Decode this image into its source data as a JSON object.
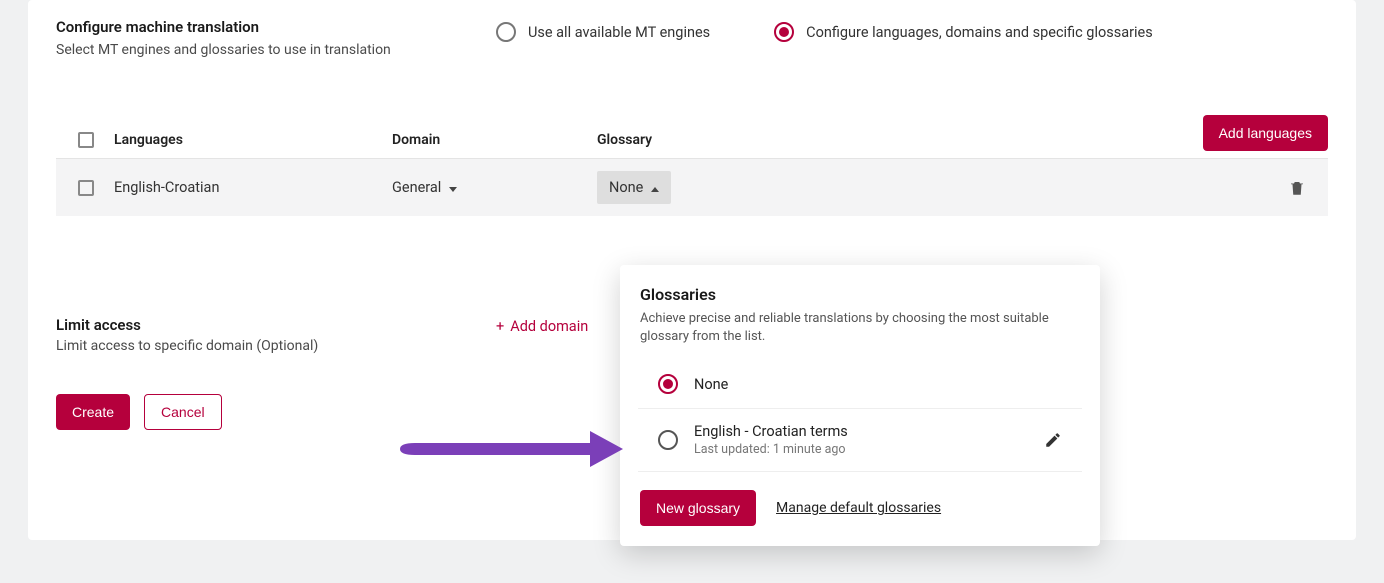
{
  "header": {
    "title": "Configure machine translation",
    "subtitle": "Select MT engines and glossaries to use in translation"
  },
  "mode_options": {
    "use_all": "Use all available MT engines",
    "configure": "Configure languages, domains and specific glossaries"
  },
  "buttons": {
    "add_languages": "Add languages",
    "create": "Create",
    "cancel": "Cancel",
    "new_glossary": "New glossary",
    "manage_glossaries": "Manage default glossaries",
    "add_domain": "Add domain"
  },
  "table": {
    "headers": {
      "languages": "Languages",
      "domain": "Domain",
      "glossary": "Glossary"
    },
    "rows": [
      {
        "languages": "English-Croatian",
        "domain": "General",
        "glossary": "None"
      }
    ]
  },
  "limit": {
    "title": "Limit access",
    "subtitle": "Limit access to specific domain (Optional)"
  },
  "glossary_panel": {
    "title": "Glossaries",
    "desc": "Achieve precise and reliable translations by choosing the most suitable glossary from the list.",
    "options": [
      {
        "title": "None",
        "sub": "",
        "selected": true
      },
      {
        "title": "English - Croatian terms",
        "sub": "Last updated: 1 minute ago",
        "selected": false
      }
    ]
  }
}
